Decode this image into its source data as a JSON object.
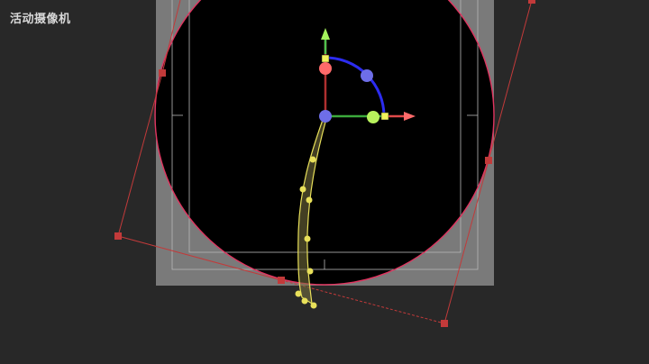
{
  "viewport": {
    "camera_label": "活动摄像机"
  },
  "colors": {
    "background": "#282828",
    "camera_frame": "#000000",
    "vignette_fill": "#7a7a7a",
    "circle_stroke": "#e0345f",
    "handle_red": "#d03a3a",
    "curve_yellow": "#e8e05a",
    "gizmo_x": "#ff6a6a",
    "gizmo_y": "#a4f25c",
    "gizmo_z": "#6e6ee8",
    "gizmo_rotate": "#2c2cf0"
  },
  "icons": {
    "transform_gizmo": "transform-gizmo-icon",
    "cage_handle": "square-handle-icon",
    "curve_point": "dot-icon"
  }
}
